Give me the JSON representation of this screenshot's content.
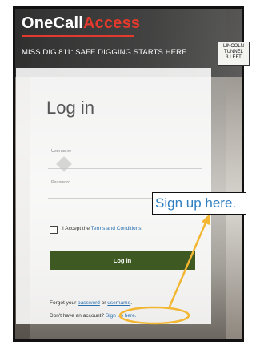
{
  "brand": {
    "part1": "OneCall",
    "part2": "Access"
  },
  "tagline": "MISS DIG 811: SAFE DIGGING STARTS HERE",
  "sign": {
    "line1": "LINCOLN",
    "line2": "TUNNEL",
    "line3": "3 LEFT"
  },
  "login": {
    "title": "Log in",
    "username_label": "Username",
    "password_label": "Password",
    "accept_prefix": "I Accept the ",
    "terms_link": "Terms and Conditions",
    "accept_suffix": ".",
    "button": "Log in",
    "forgot_prefix": "Forgot your ",
    "password_link": "password",
    "or": " or ",
    "username_link": "username",
    "forgot_suffix": ".",
    "no_account": "Don't have an account? ",
    "signup_link": "Sign up here."
  },
  "callout": {
    "text": "Sign up here."
  },
  "colors": {
    "brand_red": "#e23a2c",
    "button_green": "#3e5a22",
    "link_blue": "#2a6fb0",
    "annotation_yellow": "#f2b632",
    "callout_blue": "#2f7fc1"
  }
}
